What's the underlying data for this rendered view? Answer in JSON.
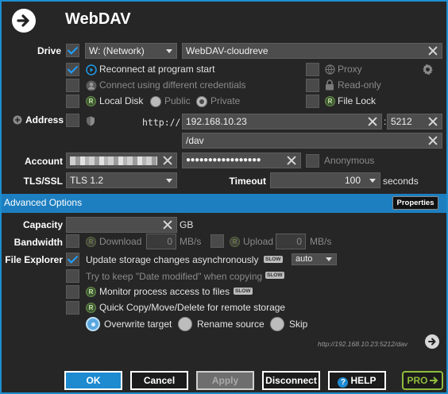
{
  "window": {
    "title": "WebDAV"
  },
  "drive": {
    "label": "Drive",
    "letter": "W: (Network)",
    "name": "WebDAV-cloudreve"
  },
  "options": {
    "reconnect": "Reconnect at program start",
    "proxy": "Proxy",
    "credentials": "Connect using different credentials",
    "readonly": "Read-only",
    "local_disk": "Local Disk",
    "public": "Public",
    "private": "Private",
    "file_lock": "File Lock"
  },
  "address": {
    "label": "Address",
    "scheme": "http://",
    "host": "192.168.10.23",
    "port": "5212",
    "path": "/dav"
  },
  "account": {
    "label": "Account",
    "password": "●●●●●●●●●●●●●●●●●",
    "anonymous": "Anonymous"
  },
  "tls": {
    "label": "TLS/SSL",
    "value": "TLS 1.2",
    "timeout_label": "Timeout",
    "timeout_value": "100",
    "timeout_unit": "seconds"
  },
  "advanced": {
    "title": "Advanced Options",
    "properties": "Properties"
  },
  "capacity": {
    "label": "Capacity",
    "unit": "GB"
  },
  "bandwidth": {
    "label": "Bandwidth",
    "download": "Download",
    "download_value": "0",
    "upload": "Upload",
    "upload_value": "0",
    "unit": "MB/s"
  },
  "explorer": {
    "label": "File Explorer",
    "update_async": "Update storage changes asynchronously",
    "mode": "auto",
    "date_modified": "Try to keep \"Date modified\" when copying",
    "monitor": "Monitor process access to files",
    "quick_copy": "Quick Copy/Move/Delete for remote storage",
    "overwrite": "Overwrite target",
    "rename": "Rename source",
    "skip": "Skip",
    "slow_badge": "SLOW"
  },
  "url_preview": "http://192.168.10.23:5212/dav",
  "buttons": {
    "ok": "OK",
    "cancel": "Cancel",
    "apply": "Apply",
    "disconnect": "Disconnect",
    "help": "HELP",
    "pro": "PRO"
  },
  "colors": {
    "accent": "#1d8ed0",
    "section_bar": "#1d7fc0",
    "ok_button": "#1e8ad0",
    "pro": "#8fbc3c"
  }
}
